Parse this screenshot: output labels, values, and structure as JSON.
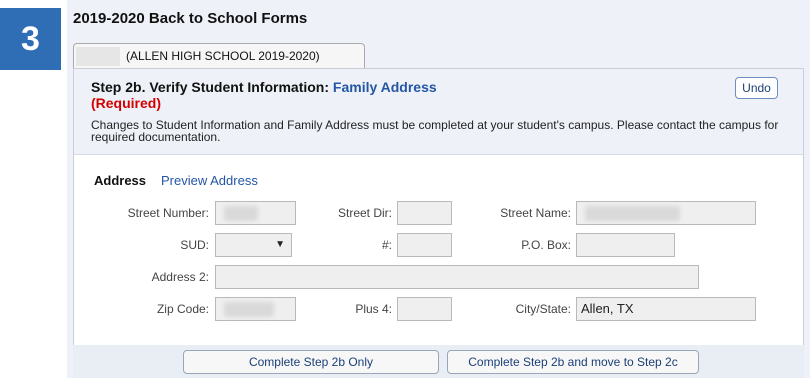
{
  "step_number": "3",
  "form_title": "2019-2020 Back to School Forms",
  "tab_label": "(ALLEN HIGH SCHOOL 2019-2020)",
  "step": {
    "title_prefix": "Step 2b. Verify Student Information: ",
    "title_highlight": "Family Address",
    "required": "(Required)",
    "notice": "Changes to Student Information and Family Address must be completed at your student's campus. Please contact the campus for required documentation.",
    "undo_label": "Undo"
  },
  "address": {
    "heading": "Address",
    "preview_link": "Preview Address",
    "labels": {
      "street_number": "Street Number:",
      "street_dir": "Street Dir:",
      "street_name": "Street Name:",
      "sud": "SUD:",
      "unit": "#:",
      "po_box": "P.O. Box:",
      "address2": "Address 2:",
      "zip": "Zip Code:",
      "plus4": "Plus 4:",
      "city_state": "City/State:"
    },
    "city_state_value": "Allen, TX",
    "sud_arrow": "▼"
  },
  "buttons": {
    "complete_only": "Complete Step 2b Only",
    "complete_next": "Complete Step 2b and move to Step 2c"
  }
}
